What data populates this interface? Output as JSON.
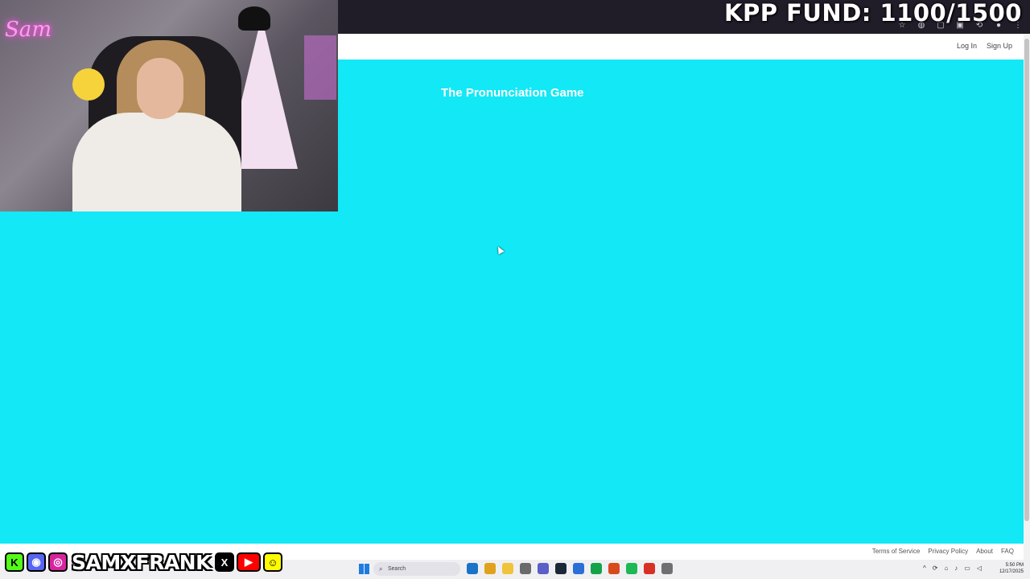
{
  "overlay": {
    "fund_text": "KPP FUND: 1100/1500",
    "neon_sign": "Sam",
    "social_handle": "SAMXFRANK",
    "social_icons": [
      "kick-icon",
      "discord-icon",
      "instagram-icon",
      "x-icon",
      "youtube-icon",
      "snapchat-icon"
    ],
    "colors": {
      "kick": "#53fc18",
      "discord": "#5865f2",
      "instagram": "#d6249f",
      "x": "#000000",
      "youtube": "#ff0000",
      "snapchat": "#fffc00"
    }
  },
  "header": {
    "login_label": "Log In",
    "signup_label": "Sign Up"
  },
  "main": {
    "title": "The Pronunciation Game",
    "background_color": "#12e8f6"
  },
  "footer": {
    "links": [
      "Terms of Service",
      "Privacy Policy",
      "About",
      "FAQ"
    ]
  },
  "taskbar": {
    "search_placeholder": "Search",
    "time": "5:50 PM",
    "date": "12/17/2025"
  }
}
